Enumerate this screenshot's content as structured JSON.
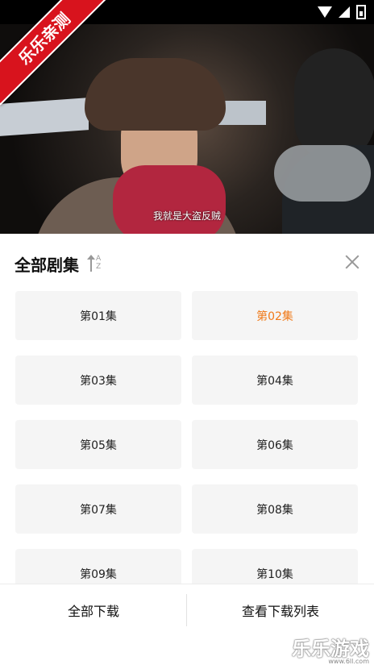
{
  "video": {
    "subtitle": "我就是大盗反贼",
    "ribbon": "乐乐亲测"
  },
  "episodes_panel": {
    "title": "全部剧集",
    "sort_letters": "A\nZ",
    "items": [
      {
        "label": "第01集",
        "active": false
      },
      {
        "label": "第02集",
        "active": true
      },
      {
        "label": "第03集",
        "active": false
      },
      {
        "label": "第04集",
        "active": false
      },
      {
        "label": "第05集",
        "active": false
      },
      {
        "label": "第06集",
        "active": false
      },
      {
        "label": "第07集",
        "active": false
      },
      {
        "label": "第08集",
        "active": false
      },
      {
        "label": "第09集",
        "active": false
      },
      {
        "label": "第10集",
        "active": false
      }
    ],
    "active_color": "#f07a1a"
  },
  "bottom_bar": {
    "download_all": "全部下载",
    "view_list": "查看下载列表"
  },
  "watermark": {
    "text": "乐乐游戏",
    "url": "www.6ll.com"
  }
}
